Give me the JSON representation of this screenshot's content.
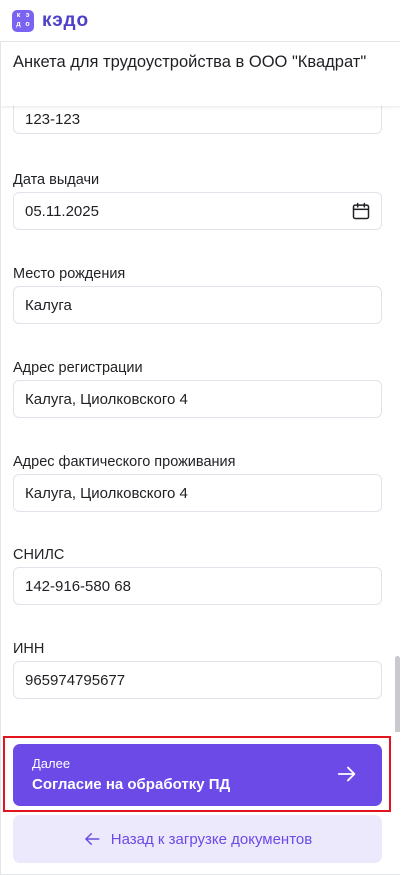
{
  "app": {
    "logo_letters": [
      "к",
      "э",
      "д",
      "о"
    ],
    "logo_text": "кэдо"
  },
  "form": {
    "title": "Анкета для трудоустройства в ООО \"Квадрат\"",
    "fields": [
      {
        "label": "",
        "value": "123-123"
      },
      {
        "label": "Дата выдачи",
        "value": "05.11.2025"
      },
      {
        "label": "Место рождения",
        "value": "Калуга"
      },
      {
        "label": "Адрес регистрации",
        "value": "Калуга, Циолковского 4"
      },
      {
        "label": "Адрес фактического проживания",
        "value": "Калуга, Циолковского 4"
      },
      {
        "label": "СНИЛС",
        "value": "142-916-580 68"
      },
      {
        "label": "ИНН",
        "value": "965974795677"
      }
    ]
  },
  "footer": {
    "next_small": "Далее",
    "next_label": "Согласие на обработку ПД",
    "back_label": "Назад к загрузке документов"
  },
  "colors": {
    "accent": "#6b4ae8",
    "back_bg": "#ede9fd",
    "highlight": "#e2141e"
  },
  "icons": [
    "calendar-icon",
    "arrow-right-icon",
    "arrow-left-icon"
  ]
}
